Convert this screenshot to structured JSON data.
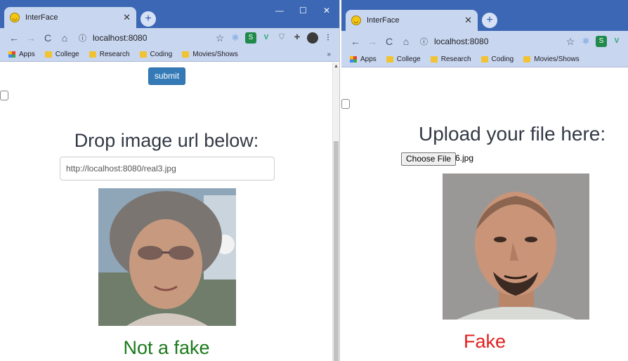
{
  "left_window": {
    "tab": {
      "title": "InterFace",
      "close": "✕"
    },
    "new_tab": "+",
    "window_controls": {
      "minimize": "—",
      "maximize": "☐",
      "close": "✕"
    },
    "toolbar": {
      "back": "←",
      "forward": "→",
      "reload": "C",
      "home": "⌂",
      "url": "localhost:8080"
    },
    "bookmarks": [
      "Apps",
      "College",
      "Research",
      "Coding",
      "Movies/Shows"
    ],
    "bookmarks_more": "»",
    "page": {
      "submit_label": "submit",
      "heading": "Drop image url below:",
      "url_value": "http://localhost:8080/real3.jpg",
      "result": "Not a fake"
    }
  },
  "right_window": {
    "tab": {
      "title": "InterFace",
      "close": "✕"
    },
    "new_tab": "+",
    "toolbar": {
      "back": "←",
      "forward": "→",
      "reload": "C",
      "home": "⌂",
      "url": "localhost:8080"
    },
    "bookmarks": [
      "Apps",
      "College",
      "Research",
      "Coding",
      "Movies/Shows"
    ],
    "page": {
      "heading": "Upload your file here:",
      "choose_file_label": "Choose File",
      "file_name": "6.jpg",
      "result": "Fake"
    }
  },
  "colors": {
    "tab_strip": "#3b67b4",
    "toolbar": "#c8d6f0",
    "submit_button": "#337ab7",
    "real_result": "#1a7a1a",
    "fake_result": "#e02020"
  }
}
